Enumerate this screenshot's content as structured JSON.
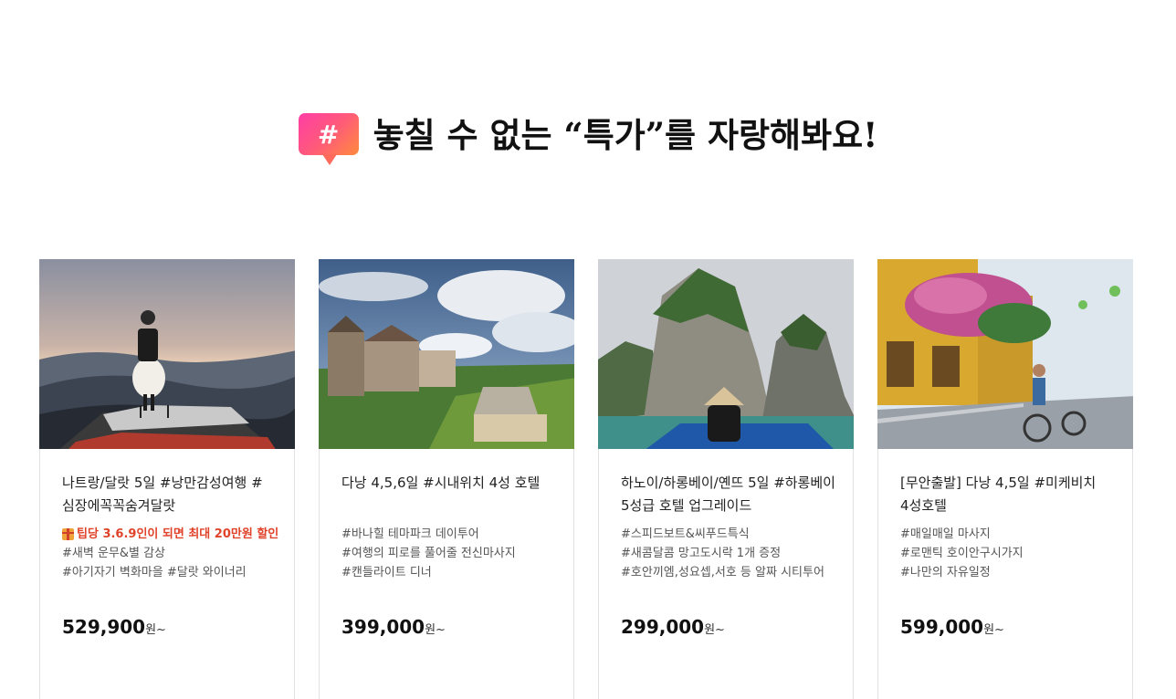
{
  "header": {
    "badge_symbol": "#",
    "title": "놓칠 수 없는 “특가”를 자랑해봐요!"
  },
  "colors": {
    "badge_gradient": [
      "#ff3da6",
      "#ff8a3d"
    ],
    "promo_text": "#e0432a"
  },
  "cards": [
    {
      "title": "나트랑/달랏 5일 #낭만감성여행 #심장에꼭꼭숨겨달랏",
      "image": "woman-on-vehicle-roof-mountain-dusk",
      "promo": "팁당 3.6.9인이 되면 최대 20만원 할인",
      "promo_icon": "gift-icon",
      "tags": [
        "#새벽 운무&별 감상",
        "#아기자기 벽화마을 #달랏 와이너리"
      ],
      "price": "529,900",
      "price_unit": "원~"
    },
    {
      "title": "다낭 4,5,6일 #시내위치 4성 호텔",
      "image": "ba-na-hills-castle-village",
      "tags": [
        "#바나힐 테마파크 데이투어",
        "#여행의 피로를 풀어줄 전신마사지",
        "#캔들라이트 디너"
      ],
      "price": "399,000",
      "price_unit": "원~"
    },
    {
      "title": "하노이/하롱베이/옌뜨 5일 #하롱베이 5성급 호텔 업그레이드",
      "image": "halong-bay-limestone-boat",
      "tags": [
        "#스피드보트&씨푸드특식",
        "#새콤달콤 망고도시락 1개 증정",
        "#호안끼엠,성요셉,서호 등 알짜 시티투어"
      ],
      "price": "299,000",
      "price_unit": "원~"
    },
    {
      "title": "[무안출발] 다낭 4,5일 #미케비치 4성호텔",
      "image": "hoi-an-yellow-street-bougainvillea",
      "tags": [
        "#매일매일 마사지",
        "#로맨틱 호이안구시가지",
        "#나만의 자유일정"
      ],
      "price": "599,000",
      "price_unit": "원~"
    }
  ]
}
